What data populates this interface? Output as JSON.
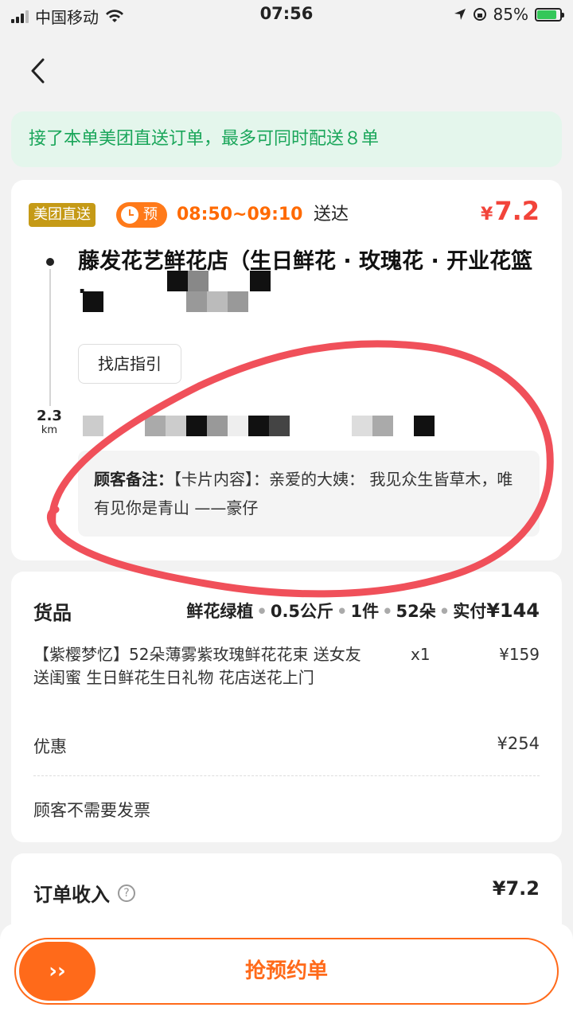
{
  "status_bar": {
    "carrier": "中国移动",
    "time": "07:56",
    "battery": "85%"
  },
  "notice": "接了本单美团直送订单，最多可同时配送８单",
  "order": {
    "tag_direct": "美团直送",
    "tag_pre": "预",
    "time_window": "08:50~09:10",
    "deliver_word": "送达",
    "price_symbol": "¥",
    "price_value": "7.2",
    "shop_name": "藤发花艺鲜花店（生日鲜花 · 玫瑰花 · 开业花篮 ·",
    "guide_button": "找店指引",
    "distance_value": "2.3",
    "distance_unit": "km",
    "remark_label": "顾客备注：",
    "remark_text": "【卡片内容】：亲爱的大姨： 我见众生皆草木，唯有见你是青山 ——豪仔"
  },
  "goods": {
    "title": "货品",
    "category": "鲜花绿植",
    "weight": "0.5公斤",
    "pieces": "1件",
    "count": "52朵",
    "paid_label": "实付",
    "paid_value": "¥144",
    "item_name": "【紫樱梦忆】52朵薄雾紫玫瑰鲜花花束 送女友送闺蜜 生日鲜花生日礼物 花店送花上门",
    "item_qty": "x1",
    "item_price": "¥159",
    "discount_label": "优惠",
    "discount_value": "¥254",
    "invoice": "顾客不需要发票"
  },
  "income": {
    "label": "订单收入",
    "value": "¥7.2"
  },
  "grab": {
    "knob": "››",
    "label": "抢预约单"
  },
  "colors": {
    "accent": "#ff6a1a",
    "price_red": "#f2443a",
    "notice_green": "#1aa65a",
    "tag_gold": "#c59a16",
    "annotation_red": "#f0505a"
  }
}
